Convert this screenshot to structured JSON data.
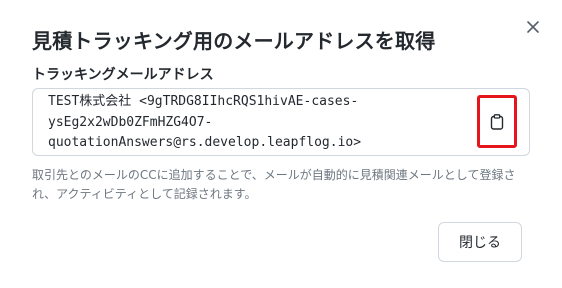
{
  "dialog": {
    "title": "見積トラッキング用のメールアドレスを取得",
    "close_icon": "close-icon"
  },
  "address": {
    "label": "トラッキングメールアドレス",
    "lines": [
      "TEST株式会社 <9gTRDG8IIhcRQS1hivAE-cases-",
      "ysEg2x2wDb0ZFmHZG4O7-",
      "quotationAnswers@rs.develop.leapflog.io>"
    ],
    "copy_icon": "clipboard-icon",
    "highlight_color": "#e4161c"
  },
  "description": "取引先とのメールのCCに追加することで、メールが自動的に見積関連メールとして登録され、アクティビティとして記録されます。",
  "footer": {
    "close_label": "閉じる"
  }
}
